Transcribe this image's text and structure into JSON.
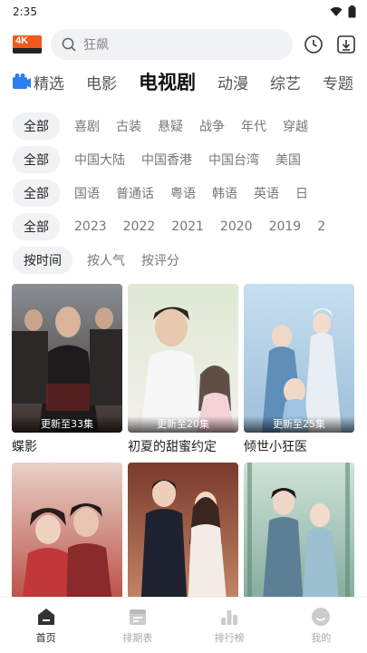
{
  "status_bar": {
    "time": "2:35"
  },
  "header": {
    "logo_text": "4K",
    "search_placeholder": "狂飙"
  },
  "tabs": [
    {
      "label": "精选",
      "active": false
    },
    {
      "label": "电影",
      "active": false
    },
    {
      "label": "电视剧",
      "active": true
    },
    {
      "label": "动漫",
      "active": false
    },
    {
      "label": "综艺",
      "active": false
    },
    {
      "label": "专题",
      "active": false
    }
  ],
  "filters": {
    "genre": [
      "全部",
      "喜剧",
      "古装",
      "悬疑",
      "战争",
      "年代",
      "穿越"
    ],
    "region": [
      "全部",
      "中国大陆",
      "中国香港",
      "中国台湾",
      "美国"
    ],
    "language": [
      "全部",
      "国语",
      "普通话",
      "粤语",
      "韩语",
      "英语",
      "日"
    ],
    "year": [
      "全部",
      "2023",
      "2022",
      "2021",
      "2020",
      "2019",
      "2"
    ],
    "sort": [
      "按时间",
      "按人气",
      "按评分"
    ]
  },
  "shows": [
    {
      "title": "蝶影",
      "badge": "更新至33集"
    },
    {
      "title": "初夏的甜蜜约定",
      "badge": "更新至20集"
    },
    {
      "title": "倾世小狂医",
      "badge": "更新至25集"
    },
    {
      "title": "",
      "badge": ""
    },
    {
      "title": "",
      "badge": ""
    },
    {
      "title": "",
      "badge": ""
    }
  ],
  "bottom_nav": [
    {
      "label": "首页",
      "icon": "home-icon",
      "active": true
    },
    {
      "label": "排期表",
      "icon": "calendar-icon",
      "active": false
    },
    {
      "label": "排行榜",
      "icon": "ranking-icon",
      "active": false
    },
    {
      "label": "我的",
      "icon": "profile-icon",
      "active": false
    }
  ],
  "colors": {
    "brand": "#f05a1a",
    "text": "#333333",
    "chip_bg": "#f1f2f4"
  }
}
